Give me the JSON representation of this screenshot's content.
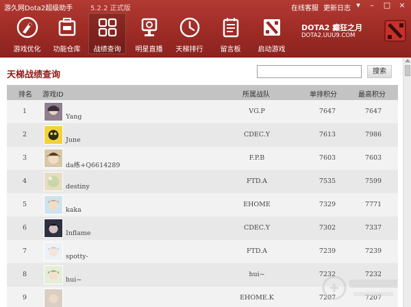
{
  "app": {
    "title": "游久网Dota2超级助手",
    "version": "5.2.2 正式版",
    "links": [
      "在线客服",
      "更新日志"
    ]
  },
  "nav": [
    {
      "label": "游戏优化",
      "icon": "rocket-icon"
    },
    {
      "label": "功能仓库",
      "icon": "toolbox-icon"
    },
    {
      "label": "战绩查询",
      "icon": "grid-icon",
      "active": true
    },
    {
      "label": "明星直播",
      "icon": "broadcast-icon"
    },
    {
      "label": "天梯排行",
      "icon": "clock-icon"
    },
    {
      "label": "留言板",
      "icon": "notepad-icon"
    },
    {
      "label": "启动游戏",
      "icon": "dota-icon"
    }
  ],
  "brand": {
    "line1": "DOTA2 癫狂之月",
    "line2": "DOTA2.UUU9.COM"
  },
  "page": {
    "title": "天梯战绩查询"
  },
  "search": {
    "value": "",
    "button_label": "搜索"
  },
  "table": {
    "headers": [
      "排名",
      "游戏ID",
      "所属战队",
      "单排积分",
      "最高积分"
    ],
    "rows": [
      {
        "rank": "1",
        "name": "Yang",
        "team": "VG.P",
        "rank_score": "7647",
        "max_score": "7647"
      },
      {
        "rank": "2",
        "name": "June",
        "team": "CDEC.Y",
        "rank_score": "7613",
        "max_score": "7986"
      },
      {
        "rank": "3",
        "name": "da练+Q6614289",
        "team": "F.P.B",
        "rank_score": "7603",
        "max_score": "7603"
      },
      {
        "rank": "4",
        "name": "destiny",
        "team": "FTD.A",
        "rank_score": "7535",
        "max_score": "7599"
      },
      {
        "rank": "5",
        "name": "kaka",
        "team": "EHOME",
        "rank_score": "7329",
        "max_score": "7771"
      },
      {
        "rank": "6",
        "name": "Inflame",
        "team": "CDEC.Y",
        "rank_score": "7302",
        "max_score": "7337"
      },
      {
        "rank": "7",
        "name": "spotty-",
        "team": "FTD.A",
        "rank_score": "7239",
        "max_score": "7239"
      },
      {
        "rank": "8",
        "name": "hui~",
        "team": "hui~",
        "rank_score": "7232",
        "max_score": "7232"
      },
      {
        "rank": "9",
        "name": "",
        "team": "EHOME.K",
        "rank_score": "7207",
        "max_score": "7207"
      }
    ]
  },
  "colors": {
    "header": "#9e2b25",
    "title": "#8b1a16",
    "table_header": "#c3c3c3"
  }
}
